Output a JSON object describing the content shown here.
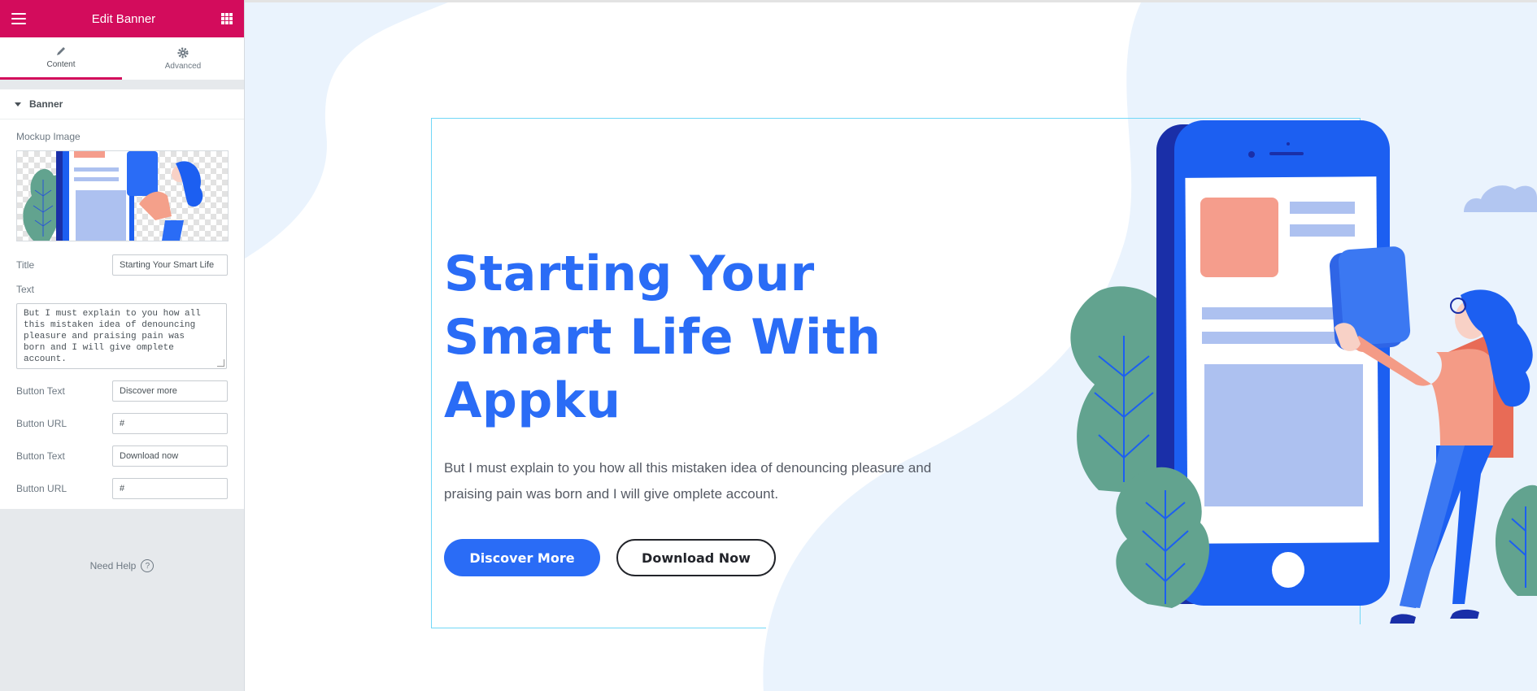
{
  "sidebar": {
    "title": "Edit Banner",
    "tabs": [
      {
        "label": "Content",
        "icon": "pencil-icon",
        "active": true
      },
      {
        "label": "Advanced",
        "icon": "gear-icon",
        "active": false
      }
    ],
    "section_title": "Banner",
    "mockup_label": "Mockup Image",
    "title_label": "Title",
    "title_value": "Starting Your Smart Life",
    "text_label": "Text",
    "text_value": "But I must explain to you how all\nthis mistaken idea of denouncing\npleasure and praising pain was\nborn and I will give omplete\naccount.",
    "button1_text_label": "Button Text",
    "button1_text_value": "Discover more",
    "button1_url_label": "Button URL",
    "button1_url_value": "#",
    "button2_text_label": "Button Text",
    "button2_text_value": "Download now",
    "button2_url_label": "Button URL",
    "button2_url_value": "#",
    "need_help": "Need Help",
    "accent_color": "#d30c5c"
  },
  "banner": {
    "title": "Starting Your Smart Life With Appku",
    "text": "But I must explain to you how all this mistaken idea of denouncing pleasure and praising pain was born and I will give omplete account.",
    "primary_button": "Discover More",
    "secondary_button": "Download Now",
    "brand_color": "#2a6cf6"
  }
}
